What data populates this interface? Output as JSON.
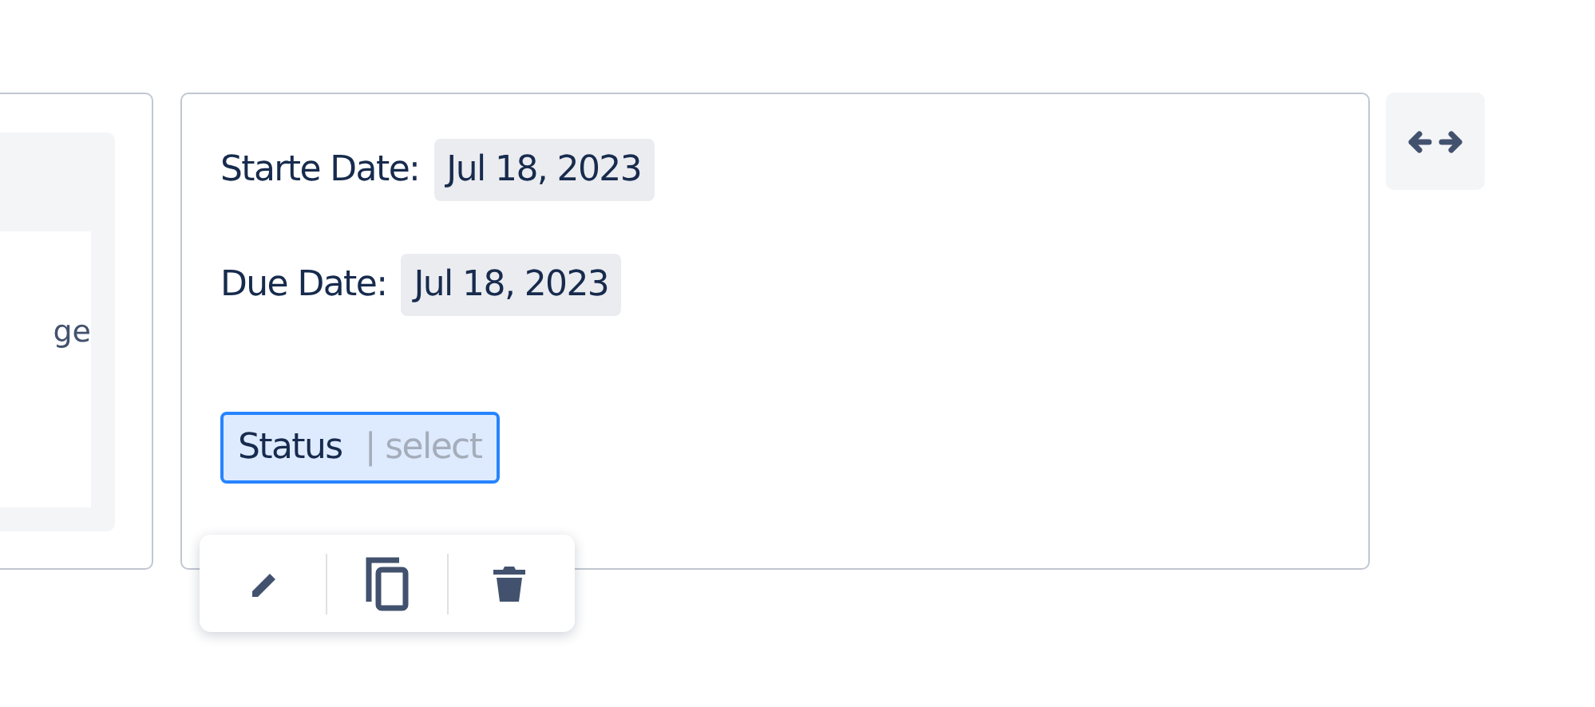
{
  "left_card": {
    "text": "ge"
  },
  "details_card": {
    "fields": [
      {
        "label": "Starte Date:",
        "value": "Jul 18, 2023"
      },
      {
        "label": "Due Date:",
        "value": "Jul 18, 2023"
      }
    ],
    "status_field": {
      "label": "Status",
      "placeholder": "| select",
      "focused": true
    }
  },
  "toolbar": {
    "actions": [
      {
        "kind": "edit"
      },
      {
        "kind": "copy"
      },
      {
        "kind": "delete"
      }
    ]
  },
  "resize_button": {
    "kind": "horizontal"
  }
}
